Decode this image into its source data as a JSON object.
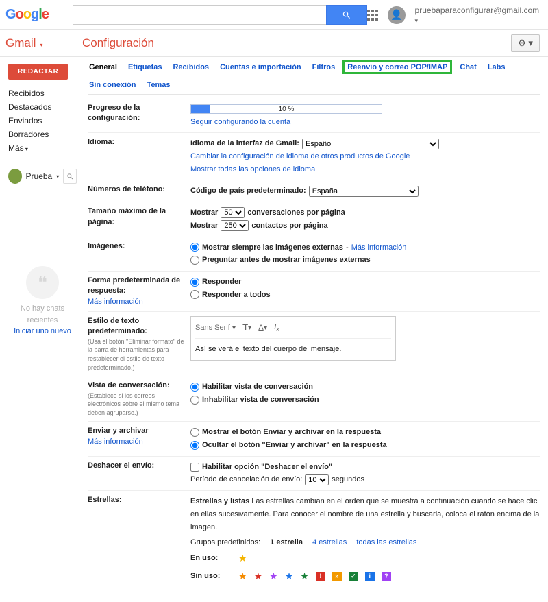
{
  "header": {
    "user_email": "pruebaparaconfigurar@gmail.com",
    "search_placeholder": ""
  },
  "brand": {
    "gmail": "Gmail",
    "page_title": "Configuración"
  },
  "sidebar": {
    "compose": "REDACTAR",
    "items": [
      "Recibidos",
      "Destacados",
      "Enviados",
      "Borradores",
      "Más"
    ],
    "profile_name": "Prueba",
    "chat_empty": "No hay chats recientes",
    "chat_start": "Iniciar uno nuevo"
  },
  "tabs": [
    "General",
    "Etiquetas",
    "Recibidos",
    "Cuentas e importación",
    "Filtros",
    "Reenvío y correo POP/IMAP",
    "Chat",
    "Labs",
    "Sin conexión",
    "Temas"
  ],
  "settings": {
    "progress": {
      "label": "Progreso de la configuración:",
      "percent_text": "10 %",
      "percent": 10,
      "link": "Seguir configurando la cuenta"
    },
    "language": {
      "label": "Idioma:",
      "ui_label": "Idioma de la interfaz de Gmail:",
      "value": "Español",
      "link1": "Cambiar la configuración de idioma de otros productos de Google",
      "link2": "Mostrar todas las opciones de idioma"
    },
    "phones": {
      "label": "Números de teléfono:",
      "code_label": "Código de país predeterminado:",
      "value": "España"
    },
    "pagesize": {
      "label": "Tamaño máximo de la página:",
      "show": "Mostrar",
      "conv_val": "50",
      "conv_suf": "conversaciones por página",
      "cont_val": "250",
      "cont_suf": "contactos por página"
    },
    "images": {
      "label": "Imágenes:",
      "opt1": "Mostrar siempre las imágenes externas",
      "more": "Más información",
      "opt2": "Preguntar antes de mostrar imágenes externas"
    },
    "reply": {
      "label": "Forma predeterminada de respuesta:",
      "more": "Más información",
      "opt1": "Responder",
      "opt2": "Responder a todos"
    },
    "textstyle": {
      "label": "Estilo de texto predeterminado:",
      "sub": "(Usa el botón \"Eliminar formato\" de la barra de herramientas para restablecer el estilo de texto predeterminado.)",
      "font": "Sans Serif",
      "sample": "Así se verá el texto del cuerpo del mensaje."
    },
    "convview": {
      "label": "Vista de conversación:",
      "sub": "(Establece si los correos electrónicos sobre el mismo tema deben agruparse.)",
      "opt1": "Habilitar vista de conversación",
      "opt2": "Inhabilitar vista de conversación"
    },
    "sendarchive": {
      "label": "Enviar y archivar",
      "more": "Más información",
      "opt1": "Mostrar el botón Enviar y archivar en la respuesta",
      "opt2": "Ocultar el botón \"Enviar y archivar\" en la respuesta"
    },
    "undo": {
      "label": "Deshacer el envío:",
      "check": "Habilitar opción \"Deshacer el envío\"",
      "period_pre": "Período de cancelación de envío:",
      "period_val": "10",
      "period_suf": "segundos"
    },
    "stars": {
      "label": "Estrellas:",
      "desc_b": "Estrellas y listas",
      "desc": "Las estrellas cambian en el orden que se muestra a continuación cuando se hace clic en ellas sucesivamente. Para conocer el nombre de una estrella y buscarla, coloca el ratón encima de la imagen.",
      "groups": "Grupos predefinidos:",
      "g1": "1 estrella",
      "g4": "4 estrellas",
      "gall": "todas las estrellas",
      "inuse": "En uso:",
      "notuse": "Sin uso:"
    }
  }
}
